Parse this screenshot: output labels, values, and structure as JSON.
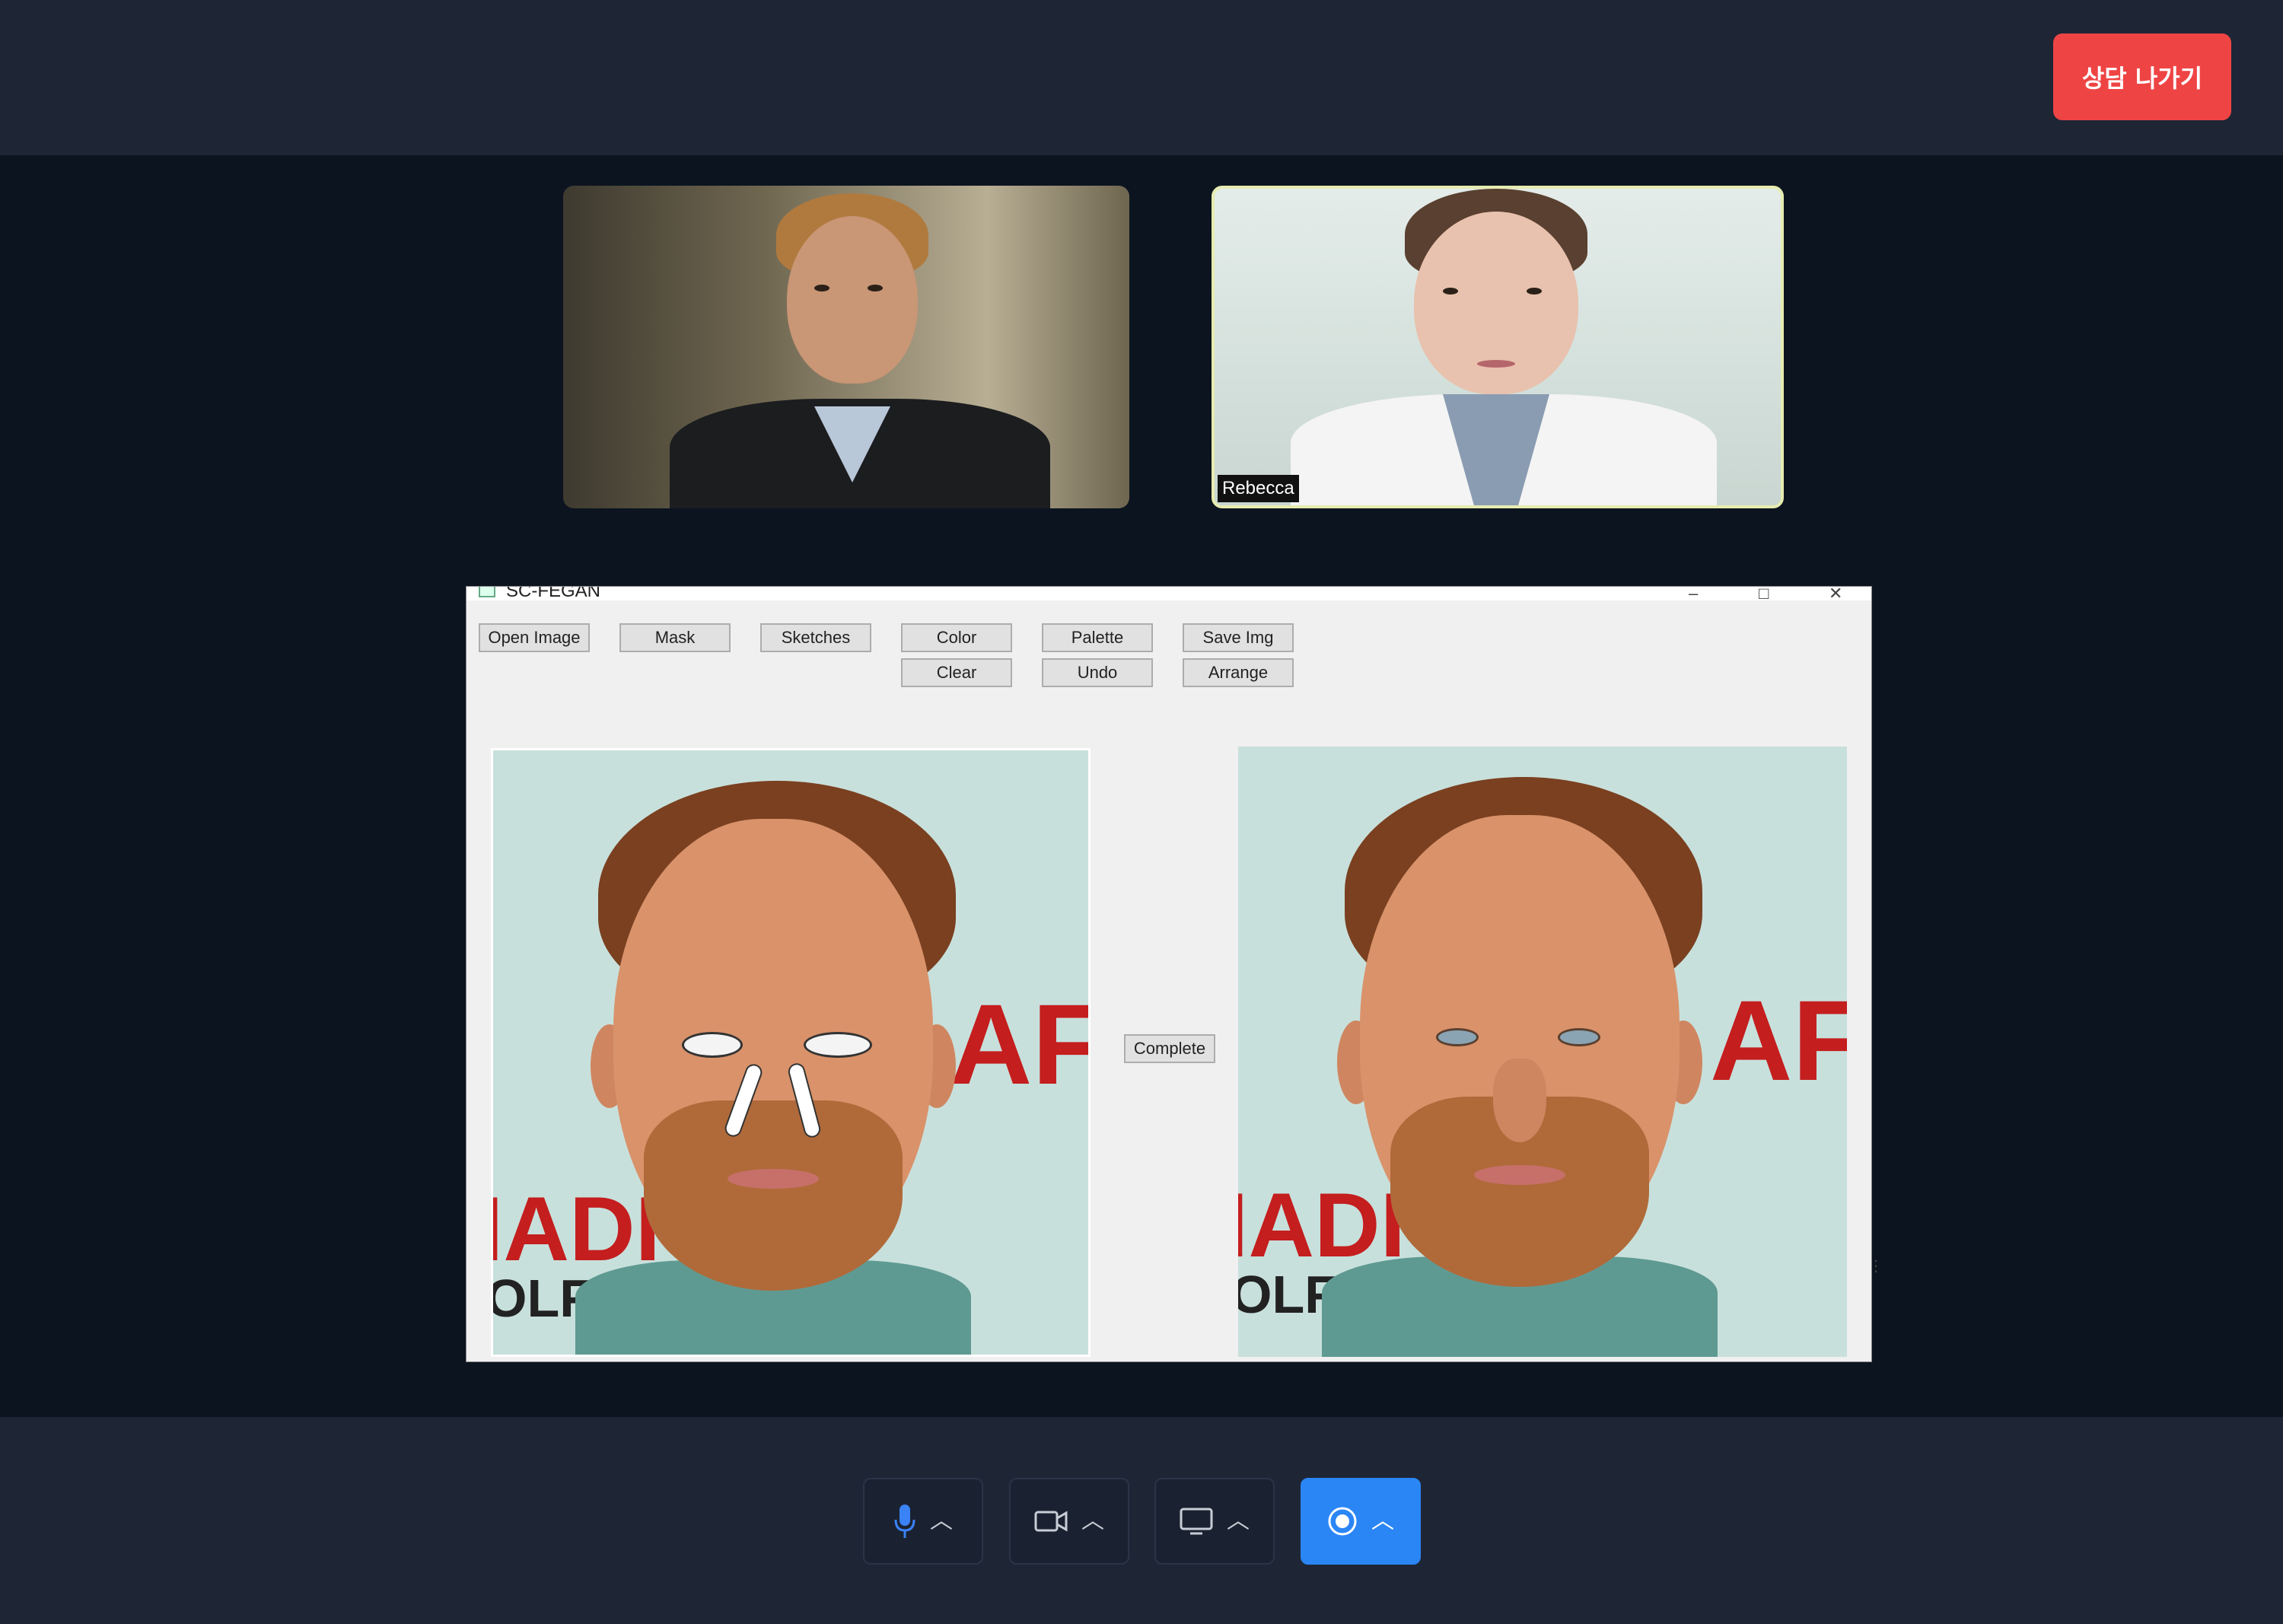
{
  "header": {
    "leave_button": "상담 나가기"
  },
  "participants": [
    {
      "name": ""
    },
    {
      "name": "Rebecca"
    }
  ],
  "app_window": {
    "title": "SC-FEGAN",
    "window_controls": [
      "minimize-icon",
      "maximize-icon",
      "close-icon"
    ],
    "toolbar_row1": [
      "Open Image",
      "Mask",
      "Sketches",
      "Color",
      "Palette",
      "Save Img"
    ],
    "toolbar_row2": [
      "Clear",
      "Undo",
      "Arrange"
    ],
    "complete_button": "Complete",
    "canvas_background_text": {
      "line1": "IADI",
      "line2": "OLF",
      "side": "AFI"
    }
  },
  "controls": [
    {
      "icon": "microphone-icon",
      "active": false
    },
    {
      "icon": "camera-icon",
      "active": false
    },
    {
      "icon": "screen-share-icon",
      "active": false
    },
    {
      "icon": "record-icon",
      "active": true
    }
  ],
  "colors": {
    "background": "#0c1420",
    "bar": "#1e2636",
    "leave": "#ef4444",
    "active_control": "#2b86f5",
    "speaker_border": "#e6ecb0"
  }
}
